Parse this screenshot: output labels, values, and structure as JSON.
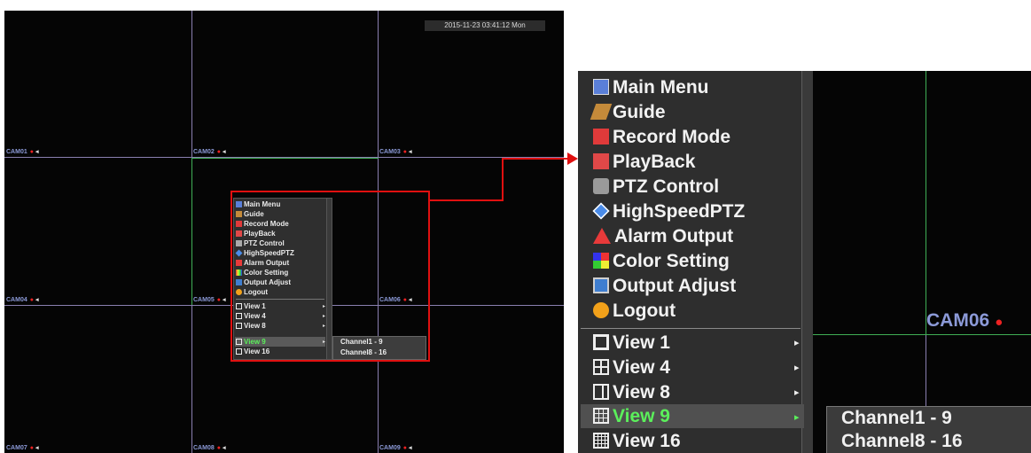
{
  "screen": {
    "datetime": "2015-11-23 03:41:12 Mon",
    "cameras": [
      {
        "label": "CAM01",
        "dot": "●",
        "speaker": "◂"
      },
      {
        "label": "CAM02",
        "dot": "●",
        "speaker": "◂"
      },
      {
        "label": "CAM03",
        "dot": "●",
        "speaker": "◂"
      },
      {
        "label": "CAM04",
        "dot": "●",
        "speaker": "◂"
      },
      {
        "label": "CAM05",
        "dot": "●",
        "speaker": "◂"
      },
      {
        "label": "CAM06",
        "dot": "●",
        "speaker": "◂"
      },
      {
        "label": "CAM07",
        "dot": "●",
        "speaker": "◂"
      },
      {
        "label": "CAM08",
        "dot": "●",
        "speaker": "◂"
      },
      {
        "label": "CAM09",
        "dot": "●",
        "speaker": "◂"
      }
    ]
  },
  "menu": {
    "items": [
      {
        "label": "Main Menu",
        "icon": "main-menu-icon"
      },
      {
        "label": "Guide",
        "icon": "guide-icon"
      },
      {
        "label": "Record Mode",
        "icon": "record-mode-icon"
      },
      {
        "label": "PlayBack",
        "icon": "playback-icon"
      },
      {
        "label": "PTZ Control",
        "icon": "ptz-camera-icon"
      },
      {
        "label": "HighSpeedPTZ",
        "icon": "highspeed-ptz-icon"
      },
      {
        "label": "Alarm Output",
        "icon": "alarm-triangle-icon"
      },
      {
        "label": "Color Setting",
        "icon": "color-grid-icon"
      },
      {
        "label": "Output Adjust",
        "icon": "output-adjust-icon"
      },
      {
        "label": "Logout",
        "icon": "power-icon"
      }
    ],
    "views": [
      {
        "label": "View 1",
        "arrow": "▸"
      },
      {
        "label": "View 4",
        "arrow": "▸"
      },
      {
        "label": "View 8",
        "arrow": "▸"
      },
      {
        "label": "View 9",
        "arrow": "▸",
        "selected": true
      },
      {
        "label": "View 16"
      }
    ],
    "submenu": [
      "Channel1 - 9",
      "Channel8 - 16"
    ]
  },
  "zoom": {
    "camera_label": "CAM06",
    "camera_dot": "●"
  },
  "colors": {
    "highlight_text": "#5bf05b",
    "callout_red": "#e01010",
    "grid_line": "#8a7fb0",
    "active_border": "#3fae55",
    "camera_label": "#8c9ad8"
  }
}
